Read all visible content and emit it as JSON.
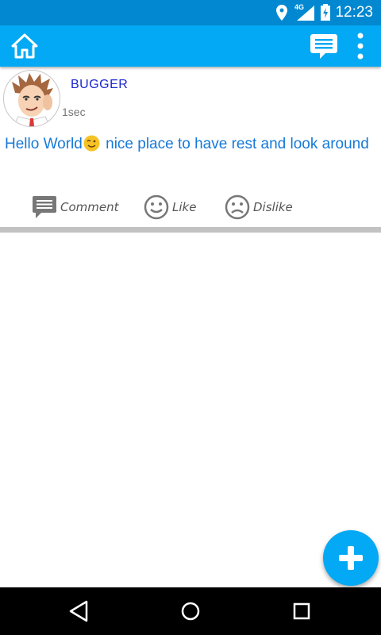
{
  "status_bar": {
    "time": "12:23",
    "network_label": "4G",
    "icons": [
      "location-icon",
      "signal-icon",
      "battery-icon"
    ]
  },
  "toolbar": {
    "icons": [
      "home-icon",
      "chat-icon",
      "more-vert-icon"
    ],
    "color": "#03a9f4"
  },
  "post": {
    "username": "BUGGER",
    "time_ago": "1sec",
    "text_before_emoji": "Hello  World",
    "emoji": "wink-emoji",
    "text_after_emoji": " nice place to have rest and look around",
    "actions": {
      "comment": "Comment",
      "like": "Like",
      "dislike": "Dislike"
    }
  },
  "fab": {
    "icon": "plus-icon"
  },
  "nav_bar": {
    "icons": [
      "back-icon",
      "home-circle-icon",
      "recents-icon"
    ]
  },
  "colors": {
    "accent": "#03a9f4",
    "status_bar": "#0288d1",
    "username": "#1a25cf",
    "post_text": "#1679d8"
  }
}
